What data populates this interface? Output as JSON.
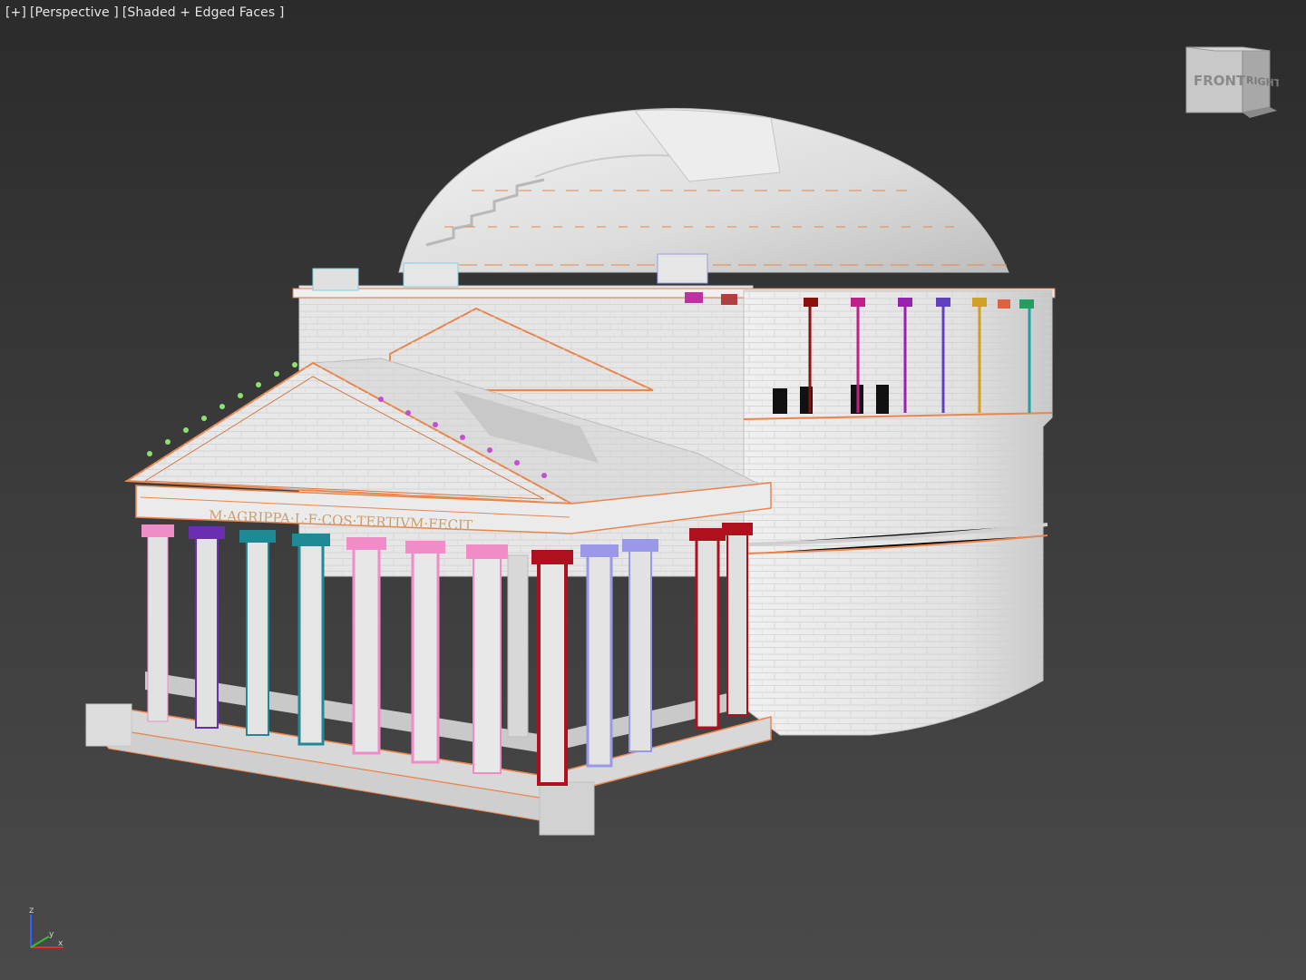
{
  "viewport": {
    "label_plus": "[+]",
    "label_view": "[Perspective ]",
    "label_shading": "[Shaded + Edged Faces ]"
  },
  "viewcube": {
    "front_label": "FRONT",
    "right_label": "RIGHT"
  },
  "axis": {
    "z_label": "z",
    "y_label": "y",
    "x_label": "x"
  },
  "model": {
    "frieze_inscription": "M·AGRIPPA·L·F·COS·TERTIVM·FECIT"
  },
  "colors": {
    "background_top": "#2b2b2b",
    "background_bottom": "#4a4a4a",
    "model_white": "#e8e8e8",
    "edge_orange": "#e8864e",
    "column_pink": "#f08cc8",
    "column_purple": "#6a2fb0",
    "column_teal": "#1f8a96",
    "column_red": "#b0101e",
    "column_lavender": "#9a98e8",
    "axis_z": "#3060ff",
    "axis_x": "#e03030",
    "axis_y": "#30c030"
  }
}
